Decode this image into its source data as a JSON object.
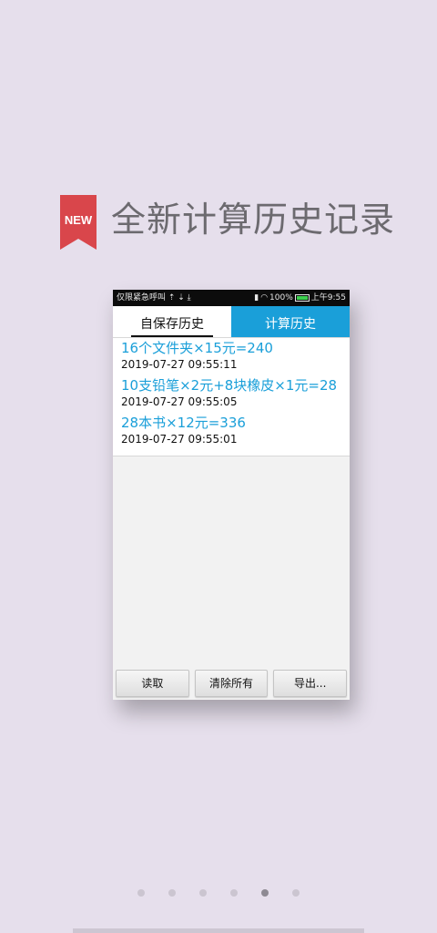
{
  "promo": {
    "badge_text": "NEW",
    "headline": "全新计算历史记录"
  },
  "statusbar": {
    "left": "仅限紧急呼叫 ⇡ ⇣ ⤓",
    "battery": "100%",
    "time": "上午9:55"
  },
  "tabs": [
    {
      "label": "自保存历史",
      "active": false
    },
    {
      "label": "计算历史",
      "active": true
    }
  ],
  "records": [
    {
      "formula": "16个文件夹×15元=240",
      "timestamp": "2019-07-27 09:55:11"
    },
    {
      "formula": "10支铅笔×2元+8块橡皮×1元=28",
      "timestamp": "2019-07-27 09:55:05"
    },
    {
      "formula": "28本书×12元=336",
      "timestamp": "2019-07-27 09:55:01"
    }
  ],
  "buttons": {
    "read": "读取",
    "clear_all": "清除所有",
    "export": "导出..."
  },
  "pager": {
    "count": 6,
    "active_index": 4
  },
  "colors": {
    "background": "#e6dfec",
    "accent": "#1a9fd9",
    "badge": "#d9464b"
  }
}
